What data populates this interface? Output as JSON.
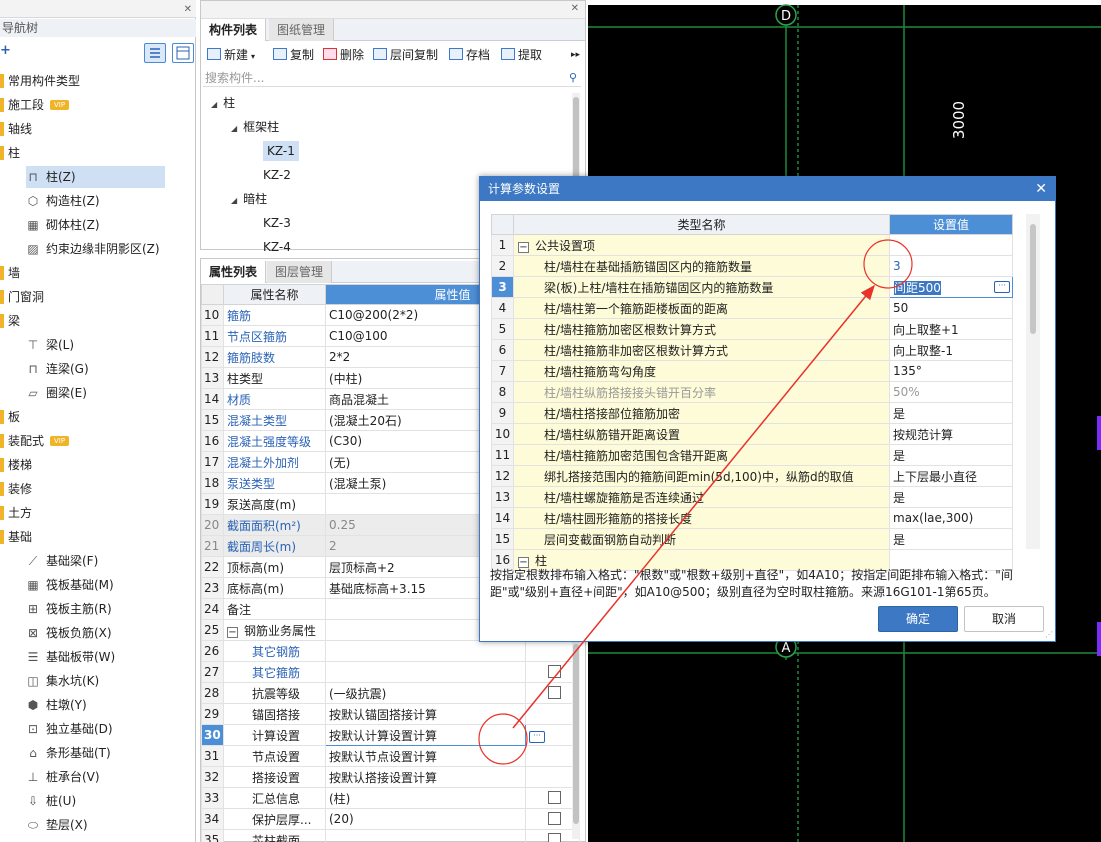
{
  "nav": {
    "title": "导航树",
    "items": [
      {
        "label": "常用构件类型",
        "type": "folder"
      },
      {
        "label": "施工段",
        "type": "folder",
        "vip": "VIP"
      },
      {
        "label": "轴线",
        "type": "folder"
      },
      {
        "label": "柱",
        "type": "folder"
      },
      {
        "label": "柱(Z)",
        "type": "child",
        "icon": "column-icon",
        "selected": true
      },
      {
        "label": "构造柱(Z)",
        "type": "child",
        "icon": "construct-column-icon"
      },
      {
        "label": "砌体柱(Z)",
        "type": "child",
        "icon": "masonry-column-icon"
      },
      {
        "label": "约束边缘非阴影区(Z)",
        "type": "child",
        "icon": "hatch-area-icon"
      },
      {
        "label": "墙",
        "type": "folder"
      },
      {
        "label": "门窗洞",
        "type": "folder"
      },
      {
        "label": "梁",
        "type": "folder"
      },
      {
        "label": "梁(L)",
        "type": "child",
        "icon": "beam-icon"
      },
      {
        "label": "连梁(G)",
        "type": "child",
        "icon": "link-beam-icon"
      },
      {
        "label": "圈梁(E)",
        "type": "child",
        "icon": "ring-beam-icon"
      },
      {
        "label": "板",
        "type": "folder"
      },
      {
        "label": "装配式",
        "type": "folder",
        "vip": "VIP"
      },
      {
        "label": "楼梯",
        "type": "folder"
      },
      {
        "label": "装修",
        "type": "folder"
      },
      {
        "label": "土方",
        "type": "folder"
      },
      {
        "label": "基础",
        "type": "folder"
      },
      {
        "label": "基础梁(F)",
        "type": "child",
        "icon": "foundation-beam-icon"
      },
      {
        "label": "筏板基础(M)",
        "type": "child",
        "icon": "raft-foundation-icon"
      },
      {
        "label": "筏板主筋(R)",
        "type": "child",
        "icon": "raft-main-rebar-icon"
      },
      {
        "label": "筏板负筋(X)",
        "type": "child",
        "icon": "raft-neg-rebar-icon"
      },
      {
        "label": "基础板带(W)",
        "type": "child",
        "icon": "slab-strip-icon"
      },
      {
        "label": "集水坑(K)",
        "type": "child",
        "icon": "sump-pit-icon"
      },
      {
        "label": "柱墩(Y)",
        "type": "child",
        "icon": "column-pier-icon"
      },
      {
        "label": "独立基础(D)",
        "type": "child",
        "icon": "isolated-footing-icon"
      },
      {
        "label": "条形基础(T)",
        "type": "child",
        "icon": "strip-footing-icon"
      },
      {
        "label": "桩承台(V)",
        "type": "child",
        "icon": "pile-cap-icon"
      },
      {
        "label": "桩(U)",
        "type": "child",
        "icon": "pile-icon"
      },
      {
        "label": "垫层(X)",
        "type": "child",
        "icon": "cushion-icon"
      }
    ]
  },
  "component_panel": {
    "tabs": [
      "构件列表",
      "图纸管理"
    ],
    "toolbar": [
      "新建",
      "复制",
      "删除",
      "层间复制",
      "存档",
      "提取"
    ],
    "search_placeholder": "搜索构件...",
    "tree": [
      {
        "label": "柱",
        "level": 0
      },
      {
        "label": "框架柱",
        "level": 1
      },
      {
        "label": "KZ-1",
        "level": 2,
        "selected": true
      },
      {
        "label": "KZ-2",
        "level": 2
      },
      {
        "label": "暗柱",
        "level": 1
      },
      {
        "label": "KZ-3",
        "level": 2
      },
      {
        "label": "KZ-4",
        "level": 2
      }
    ]
  },
  "property_panel": {
    "tabs": [
      "属性列表",
      "图层管理"
    ],
    "headers": [
      "属性名称",
      "属性值"
    ],
    "rows": [
      {
        "num": "10",
        "name": "箍筋",
        "value": "C10@200(2*2)",
        "blue": true
      },
      {
        "num": "11",
        "name": "节点区箍筋",
        "value": "C10@100",
        "blue": true
      },
      {
        "num": "12",
        "name": "箍筋肢数",
        "value": "2*2",
        "blue": true
      },
      {
        "num": "13",
        "name": "柱类型",
        "value": "(中柱)"
      },
      {
        "num": "14",
        "name": "材质",
        "value": "商品混凝土",
        "blue": true
      },
      {
        "num": "15",
        "name": "混凝土类型",
        "value": "(混凝土20石)",
        "blue": true
      },
      {
        "num": "16",
        "name": "混凝土强度等级",
        "value": "(C30)",
        "blue": true
      },
      {
        "num": "17",
        "name": "混凝土外加剂",
        "value": "(无)",
        "blue": true
      },
      {
        "num": "18",
        "name": "泵送类型",
        "value": "(混凝土泵)",
        "blue": true
      },
      {
        "num": "19",
        "name": "泵送高度(m)",
        "value": ""
      },
      {
        "num": "20",
        "name": "截面面积(m²)",
        "value": "0.25",
        "blue": true,
        "gray": true
      },
      {
        "num": "21",
        "name": "截面周长(m)",
        "value": "2",
        "blue": true,
        "gray": true
      },
      {
        "num": "22",
        "name": "顶标高(m)",
        "value": "层顶标高+2"
      },
      {
        "num": "23",
        "name": "底标高(m)",
        "value": "基础底标高+3.15"
      },
      {
        "num": "24",
        "name": "备注",
        "value": ""
      },
      {
        "num": "25",
        "name": "钢筋业务属性",
        "value": "",
        "group": true
      },
      {
        "num": "26",
        "name": "其它钢筋",
        "value": "",
        "indent": true,
        "blue": true
      },
      {
        "num": "27",
        "name": "其它箍筋",
        "value": "",
        "indent": true,
        "blue": true,
        "check": true
      },
      {
        "num": "28",
        "name": "抗震等级",
        "value": "(一级抗震)",
        "indent": true,
        "check": true
      },
      {
        "num": "29",
        "name": "锚固搭接",
        "value": "按默认锚固搭接计算",
        "indent": true
      },
      {
        "num": "30",
        "name": "计算设置",
        "value": "按默认计算设置计算",
        "indent": true,
        "selected": true
      },
      {
        "num": "31",
        "name": "节点设置",
        "value": "按默认节点设置计算",
        "indent": true
      },
      {
        "num": "32",
        "name": "搭接设置",
        "value": "按默认搭接设置计算",
        "indent": true
      },
      {
        "num": "33",
        "name": "汇总信息",
        "value": "(柱)",
        "indent": true,
        "check": true
      },
      {
        "num": "34",
        "name": "保护层厚...",
        "value": "(20)",
        "indent": true,
        "check": true
      },
      {
        "num": "35",
        "name": "芯柱截面...",
        "value": "",
        "indent": true,
        "check": true
      }
    ]
  },
  "cad": {
    "axis_labels": [
      "D",
      "A"
    ],
    "dimension": "3000"
  },
  "dialog": {
    "title": "计算参数设置",
    "headers": [
      "类型名称",
      "设置值"
    ],
    "rows": [
      {
        "num": "1",
        "name": "公共设置项",
        "value": "",
        "group": true
      },
      {
        "num": "2",
        "name": "柱/墙柱在基础插筋锚固区内的箍筋数量",
        "value": "3",
        "value_blue": true
      },
      {
        "num": "3",
        "name": "梁(板)上柱/墙柱在插筋锚固区内的箍筋数量",
        "value": "间距500",
        "selected": true
      },
      {
        "num": "4",
        "name": "柱/墙柱第一个箍筋距楼板面的距离",
        "value": "50"
      },
      {
        "num": "5",
        "name": "柱/墙柱箍筋加密区根数计算方式",
        "value": "向上取整+1"
      },
      {
        "num": "6",
        "name": "柱/墙柱箍筋非加密区根数计算方式",
        "value": "向上取整-1"
      },
      {
        "num": "7",
        "name": "柱/墙柱箍筋弯勾角度",
        "value": "135°"
      },
      {
        "num": "8",
        "name": "柱/墙柱纵筋搭接接头错开百分率",
        "value": "50%",
        "disabled": true
      },
      {
        "num": "9",
        "name": "柱/墙柱搭接部位箍筋加密",
        "value": "是"
      },
      {
        "num": "10",
        "name": "柱/墙柱纵筋错开距离设置",
        "value": "按规范计算"
      },
      {
        "num": "11",
        "name": "柱/墙柱箍筋加密范围包含错开距离",
        "value": "是"
      },
      {
        "num": "12",
        "name": "绑扎搭接范围内的箍筋间距min(5d,100)中，纵筋d的取值",
        "value": "上下层最小直径"
      },
      {
        "num": "13",
        "name": "柱/墙柱螺旋箍筋是否连续通过",
        "value": "是"
      },
      {
        "num": "14",
        "name": "柱/墙柱圆形箍筋的搭接长度",
        "value": "max(lae,300)"
      },
      {
        "num": "15",
        "name": "层间变截面钢筋自动判断",
        "value": "是"
      },
      {
        "num": "16",
        "name": "柱",
        "value": "",
        "group": true
      }
    ],
    "note": "按指定根数排布输入格式：\"根数\"或\"根数+级别+直径\"，如4A10；按指定间距排布输入格式：\"间距\"或\"级别+直径+间距\"，如A10@500；级别直径为空时取柱箍筋。来源16G101-1第65页。",
    "ok": "确定",
    "cancel": "取消"
  },
  "colors": {
    "accent": "#3c78c3",
    "header_blue": "#4d8fd6",
    "annotation_red": "#e8322a",
    "cad_grid": "#1f8a3c",
    "cad_marker": "#7a2cff",
    "name_cell_yellow": "#fdfbd8"
  }
}
